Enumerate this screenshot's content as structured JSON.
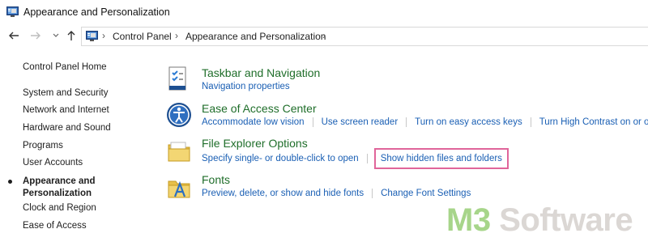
{
  "window": {
    "title": "Appearance and Personalization"
  },
  "address": {
    "crumbs": [
      "Control Panel",
      "Appearance and Personalization"
    ],
    "separator": "›",
    "back_icon": "back-arrow-icon",
    "forward_icon": "forward-arrow-icon",
    "recent_icon": "chevron-down-icon",
    "up_icon": "up-arrow-icon"
  },
  "sidebar": {
    "home": "Control Panel Home",
    "items": [
      "System and Security",
      "Network and Internet",
      "Hardware and Sound",
      "Programs",
      "User Accounts",
      "Appearance and Personalization",
      "Clock and Region",
      "Ease of Access"
    ],
    "current_index": 5,
    "current_line1": "Appearance and",
    "current_line2": "Personalization"
  },
  "categories": [
    {
      "title": "Taskbar and Navigation",
      "icon": "taskbar-checklist-icon",
      "links": [
        "Navigation properties"
      ]
    },
    {
      "title": "Ease of Access Center",
      "icon": "ease-of-access-icon",
      "links": [
        "Accommodate low vision",
        "Use screen reader",
        "Turn on easy access keys",
        "Turn High Contrast on or off"
      ]
    },
    {
      "title": "File Explorer Options",
      "icon": "folder-options-icon",
      "links": [
        "Specify single- or double-click to open",
        "Show hidden files and folders"
      ],
      "highlighted_link": "Show hidden files and folders"
    },
    {
      "title": "Fonts",
      "icon": "fonts-folder-icon",
      "links": [
        "Preview, delete, or show and hide fonts",
        "Change Font Settings"
      ]
    }
  ],
  "watermark": {
    "part1": "M3",
    "part2": " Software"
  },
  "colors": {
    "category_title": "#1f6e2a",
    "link": "#1a5fb4",
    "highlight_border": "#e0659a",
    "watermark_m3": "#a7d58a",
    "watermark_rest": "#dbd7d4"
  }
}
